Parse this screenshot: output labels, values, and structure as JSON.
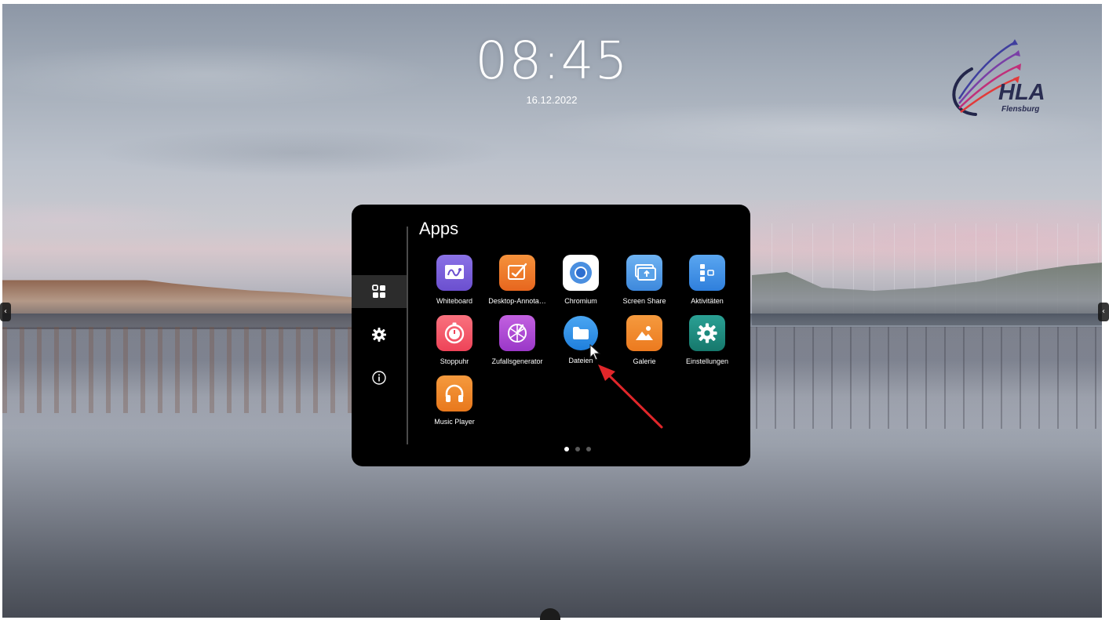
{
  "desktop": {
    "time": "08:45",
    "date": "16.12.2022",
    "logo_text": "HLA",
    "logo_subtext": "Flensburg"
  },
  "launcher": {
    "title": "Apps",
    "sidebar": [
      {
        "id": "apps",
        "icon": "grid-icon",
        "active": true
      },
      {
        "id": "settings",
        "icon": "gear-icon",
        "active": false
      },
      {
        "id": "info",
        "icon": "info-icon",
        "active": false
      }
    ],
    "apps": [
      {
        "label": "Whiteboard",
        "icon": "whiteboard-icon",
        "color": "#7b61d6"
      },
      {
        "label": "Desktop-Annota…",
        "icon": "annotation-icon",
        "color": "#f07a2c"
      },
      {
        "label": "Chromium",
        "icon": "chromium-icon",
        "color": "#ffffff"
      },
      {
        "label": "Screen Share",
        "icon": "screen-share-icon",
        "color": "#4a9be8"
      },
      {
        "label": "Aktivitäten",
        "icon": "activities-icon",
        "color": "#3d8fe6"
      },
      {
        "label": "Stoppuhr",
        "icon": "stopwatch-icon",
        "color": "#f0566a"
      },
      {
        "label": "Zufallsgenerator",
        "icon": "randomizer-icon",
        "color": "#b14bd6"
      },
      {
        "label": "Dateien",
        "icon": "folder-icon",
        "color": "#2f8fe8"
      },
      {
        "label": "Galerie",
        "icon": "gallery-icon",
        "color": "#f0862a"
      },
      {
        "label": "Einstellungen",
        "icon": "settings-icon",
        "color": "#1f8a7e"
      },
      {
        "label": "Music Player",
        "icon": "headphones-icon",
        "color": "#f08a2a"
      }
    ],
    "pager": {
      "pages": 3,
      "current": 1
    }
  },
  "annotation": {
    "arrow_color": "#e0262a"
  }
}
